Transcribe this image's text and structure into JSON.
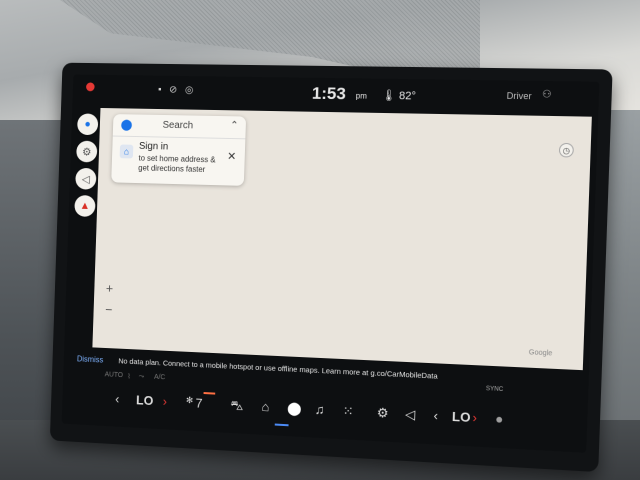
{
  "status_bar": {
    "time": "1:53",
    "ampm": "pm",
    "temperature": "82°",
    "profile": "Driver"
  },
  "left_rail": {
    "items": [
      "mic-icon",
      "settings-icon",
      "volume-icon",
      "navigation-icon"
    ]
  },
  "search_card": {
    "search_label": "Search",
    "sign_in_title": "Sign in",
    "sign_in_subtitle": "to set home address & get directions faster",
    "close_glyph": "✕"
  },
  "map": {
    "zoom_in": "+",
    "zoom_out": "−",
    "attribution": "Google"
  },
  "banner": {
    "dismiss_label": "Dismiss",
    "message": "No data plan. Connect to a mobile hotspot or use offline maps. Learn more at g.co/CarMobileData",
    "sync": "SYNC"
  },
  "climate": {
    "auto": "AUTO",
    "ac": "A/C",
    "left_setting": "LO",
    "right_setting": "LO",
    "fan_level": "7"
  },
  "dock": {
    "icons": [
      "car-icon",
      "home-icon",
      "maps-icon",
      "music-icon",
      "apps-grid-icon",
      "settings-icon",
      "volume-icon",
      "mic-icon"
    ],
    "active": "maps-icon"
  },
  "colors": {
    "map_background": "#e9e4dc",
    "accent_blue": "#1a73e8",
    "alert_red": "#e53935",
    "dismiss_blue": "#7fb3ff"
  }
}
